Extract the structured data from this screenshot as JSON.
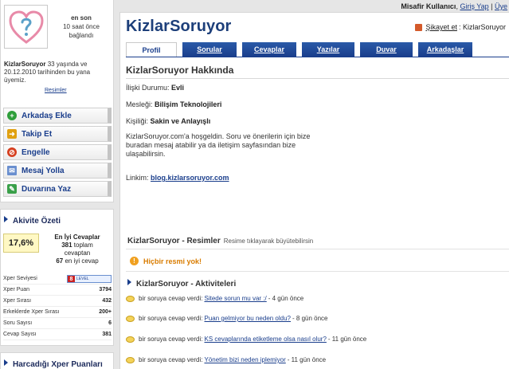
{
  "topbar": {
    "guest": "Misafir Kullanıcı",
    "login": "Giriş Yap",
    "register": "Üye"
  },
  "profile": {
    "lastseen_line1": "en son",
    "lastseen_line2": "10 saat önce",
    "lastseen_line3": "bağlandı",
    "username": "KizlarSoruyor",
    "bio_rest1": " 33 yaşında ve",
    "bio_rest2": "20.12.2010 tarihinden bu yana",
    "bio_rest3": "üyemiz.",
    "photos_link": "Resimler"
  },
  "actions": [
    {
      "label": "Arkadaş Ekle",
      "icon": "plus-icon",
      "color": "#2e9e3a"
    },
    {
      "label": "Takip Et",
      "icon": "follow-icon",
      "color": "#e0a010"
    },
    {
      "label": "Engelle",
      "icon": "block-icon",
      "color": "#d64020"
    },
    {
      "label": "Mesaj Yolla",
      "icon": "envelope-icon",
      "color": "#6a8fcf"
    },
    {
      "label": "Duvarına Yaz",
      "icon": "wall-write-icon",
      "color": "#3aa04a"
    }
  ],
  "activity": {
    "title": "Akivite Özeti",
    "pct": "17,6%",
    "best_title": "En İyi Cevaplar",
    "total_count": "381",
    "total_text": " toplam",
    "answers_text": "cevaptan",
    "best_count": "67",
    "best_text": " en iyi cevap",
    "stats": [
      {
        "label": "Xper Seviyesi",
        "value": ""
      },
      {
        "label": "Xper Puan",
        "value": "3794"
      },
      {
        "label": "Xper Sırası",
        "value": "432"
      },
      {
        "label": "Erkeklerde Xper Sırası",
        "value": "200+"
      },
      {
        "label": "Soru Sayısı",
        "value": "6"
      },
      {
        "label": "Cevap Sayısı",
        "value": "381"
      }
    ],
    "level_num": "8",
    "level_text": "LEVEL"
  },
  "xper_section": {
    "title": "Harcadığı Xper Puanları"
  },
  "main": {
    "brand": "KizlarSoruyor",
    "report_link": "Şikayet et",
    "report_suffix": ": KizlarSoruyor",
    "tabs": [
      "Profil",
      "Sorular",
      "Cevaplar",
      "Yazılar",
      "Duvar",
      "Arkadaşlar"
    ],
    "about_title": "KizlarSoruyor Hakkında",
    "relationship_label": "İlişki Durumu: ",
    "relationship_value": "Evli",
    "job_label": "Mesleği: ",
    "job_value": "Bilişim Teknolojileri",
    "personality_label": "Kişiliği: ",
    "personality_value": "Sakin ve Anlayışlı",
    "welcome_text": "KizlarSoruyor.com'a hoşgeldin. Soru ve önerilerin için bize buradan mesaj atabilir ya da iletişim sayfasından bize ulaşabilirsin.",
    "link_label": "Linkim: ",
    "link_value": "blog.kizlarsoruyor.com",
    "photos_title": "KizlarSoruyor - Resimler",
    "photos_hint": "Resime tıklayarak büyütebilirsin",
    "no_photo": "Hiçbir resmi yok!",
    "activities_title": "KizlarSoruyor - Aktiviteleri",
    "activities": [
      {
        "prefix": "bir soruya cevap verdi:",
        "link": "Sitede sorun mu var :/",
        "time": " - 4 gün önce"
      },
      {
        "prefix": "bir soruya cevap verdi:",
        "link": "Puan gelmiyor bu neden oldu?",
        "time": " - 8 gün önce"
      },
      {
        "prefix": "bir soruya cevap verdi:",
        "link": "KS cevaplarında etiketleme olsa nasıl olur?",
        "time": " - 11 gün önce"
      },
      {
        "prefix": "bir soruya cevap verdi:",
        "link": "Yönetim bizi neden iplemiyor",
        "time": " - 11 gün önce"
      }
    ]
  }
}
